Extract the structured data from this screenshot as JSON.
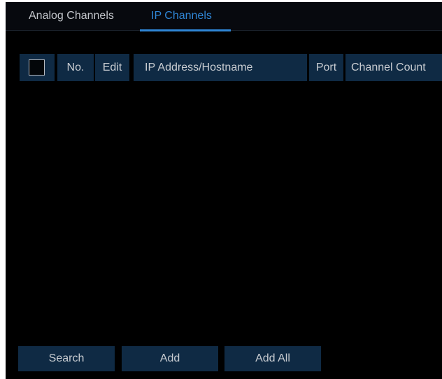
{
  "tabs": [
    {
      "label": "Analog Channels",
      "active": false
    },
    {
      "label": "IP Channels",
      "active": true
    }
  ],
  "table": {
    "columns": [
      "No.",
      "Edit",
      "IP Address/Hostname",
      "Port",
      "Channel Count"
    ],
    "select_all_checked": false,
    "rows": []
  },
  "buttons": {
    "search": "Search",
    "add": "Add",
    "add_all": "Add All"
  },
  "colors": {
    "accent": "#2f86d6",
    "header_bg": "#0f2a44",
    "panel_bg": "#000000"
  }
}
